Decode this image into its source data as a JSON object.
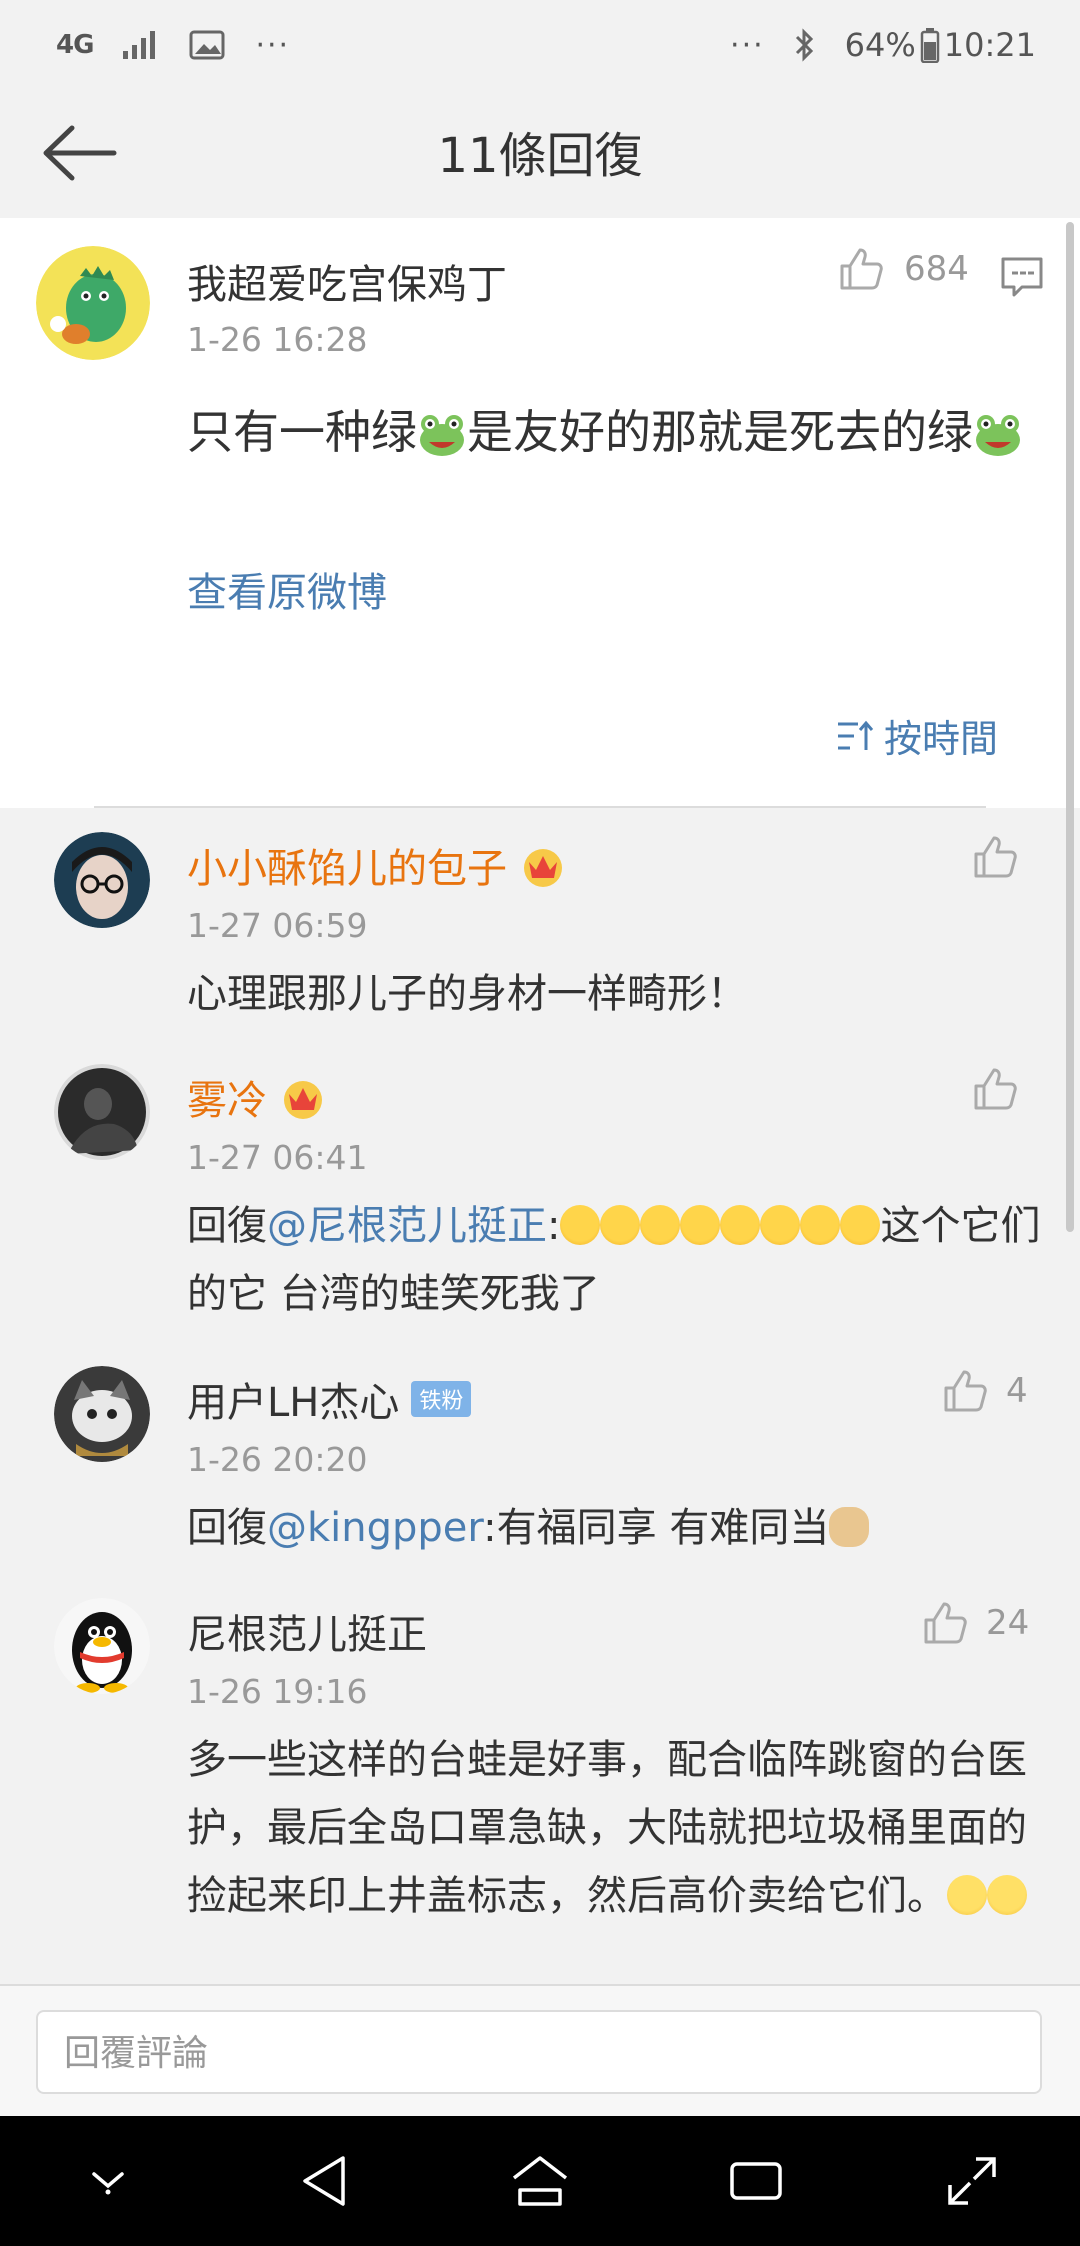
{
  "status_bar": {
    "network": "4G",
    "dots_left": "···",
    "dots_right": "···",
    "battery": "64%",
    "time": "10:21"
  },
  "header": {
    "title": "11條回復"
  },
  "post": {
    "username": "我超爱吃宫保鸡丁",
    "time": "1-26 16:28",
    "likes": "684",
    "text_part1": "只有一种绿",
    "text_part2": "是友好的那就是死去的绿",
    "view_original": "查看原微博",
    "sort_label": "按時間"
  },
  "replies": [
    {
      "username": "小小酥馅儿的包子",
      "time": "1-27 06:59",
      "text": "心理跟那儿子的身材一样畸形！"
    },
    {
      "username": "雾冷",
      "time": "1-27 06:41",
      "prefix": "回復",
      "mention": "@尼根范儿挺正",
      "colon": ":",
      "text_after": "这个它们的它 台湾的蛙笑死我了"
    },
    {
      "username": "用户LH杰心",
      "badge": "铁粉",
      "time": "1-26 20:20",
      "likes": "4",
      "prefix": "回復",
      "mention": "@kingpper",
      "text_after": ":有福同享 有难同当"
    },
    {
      "username": "尼根范儿挺正",
      "time": "1-26 19:16",
      "likes": "24",
      "text": "多一些这样的台蛙是好事，配合临阵跳窗的台医护，最后全岛口罩急缺，大陆就把垃圾桶里面的捡起来印上井盖标志，然后高价卖给它们。"
    }
  ],
  "input": {
    "placeholder": "回覆評論"
  },
  "colors": {
    "link": "#4a7db1",
    "vip_name": "#e8740f",
    "muted": "#999999"
  }
}
